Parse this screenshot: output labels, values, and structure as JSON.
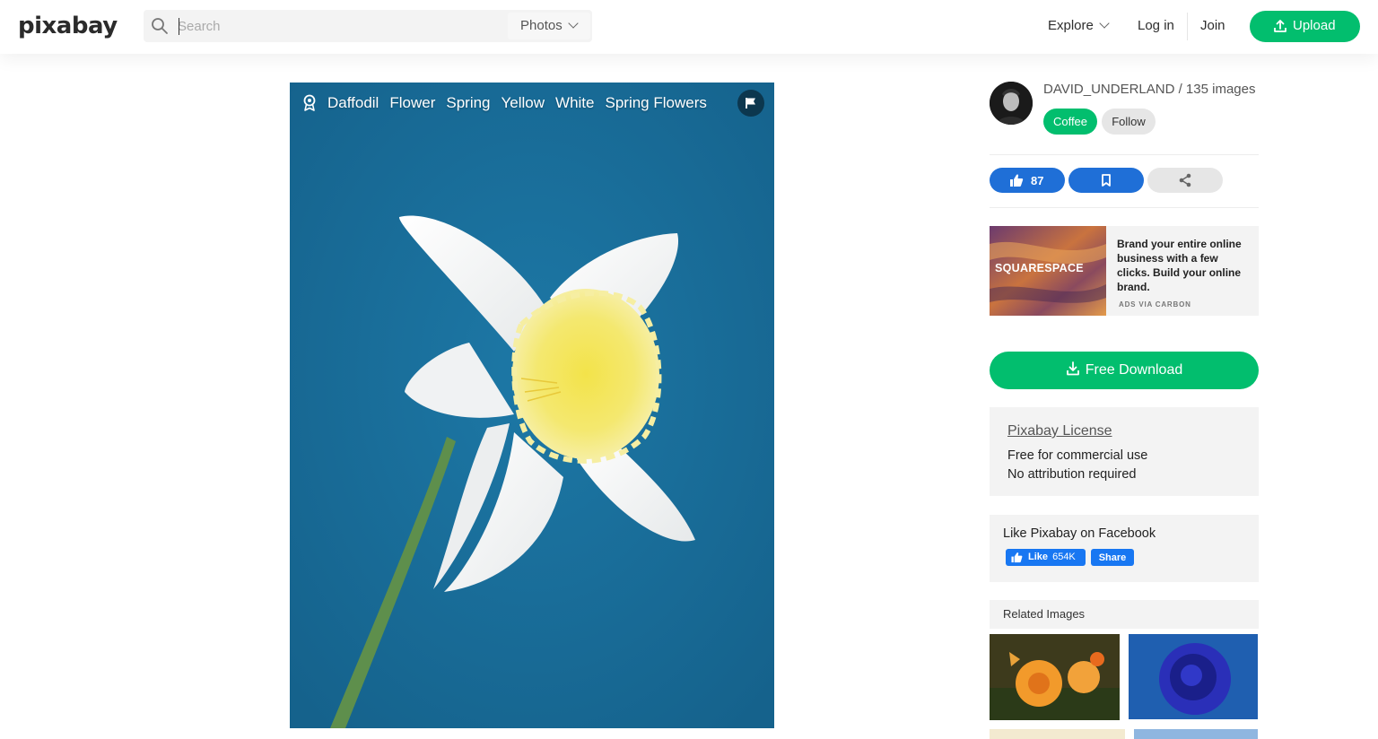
{
  "header": {
    "logo": "pixabay",
    "search_placeholder": "Search",
    "search_type": "Photos",
    "nav_explore": "Explore",
    "nav_login": "Log in",
    "nav_join": "Join",
    "upload_label": "Upload",
    "accent": "#02be6e"
  },
  "photo": {
    "tags": [
      "Daffodil",
      "Flower",
      "Spring",
      "Yellow",
      "White",
      "Spring Flowers"
    ],
    "background_color": "#1b6d99"
  },
  "author": {
    "name_line": "DAVID_UNDERLAND / 135 images",
    "coffee_label": "Coffee",
    "follow_label": "Follow"
  },
  "actions": {
    "likes": "87",
    "like_color": "#1f6fd7"
  },
  "ad": {
    "logo": "SQUARESPACE",
    "text": "Brand your entire online business with a few clicks. Build your online brand.",
    "via": "ADS VIA CARBON"
  },
  "download": {
    "label": "Free Download"
  },
  "license": {
    "link": "Pixabay License",
    "line1": "Free for commercial use",
    "line2": "No attribution required"
  },
  "facebook": {
    "title": "Like Pixabay on Facebook",
    "like_label": "Like",
    "like_count": "654K",
    "share_label": "Share"
  },
  "related": {
    "title": "Related Images"
  }
}
